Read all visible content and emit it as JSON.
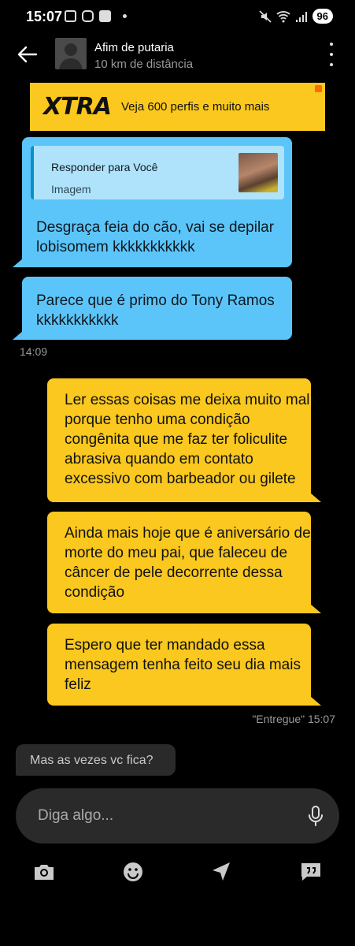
{
  "status_bar": {
    "time": "15:07",
    "battery": "96"
  },
  "header": {
    "name": "Afim de putaria",
    "distance": "10 km de distância"
  },
  "banner": {
    "logo": "XTRA",
    "text": "Veja 600 perfis e muito mais",
    "color": "#fac81e"
  },
  "conversation": {
    "incoming": [
      {
        "reply_to": "Responder para Você",
        "reply_type": "Imagem",
        "text": "Desgraça feia do cão, vai se depilar lobisomem kkkkkkkkkkk"
      },
      {
        "text": "Parece que é primo do Tony Ramos kkkkkkkkkkk"
      }
    ],
    "incoming_time": "14:09",
    "outgoing": [
      {
        "text": "Ler essas coisas me deixa muito mal porque tenho uma condição congênita que me faz ter foliculite abrasiva quando em contato excessivo com barbeador ou gilete"
      },
      {
        "text": "Ainda mais hoje que é aniversário de morte do meu pai, que faleceu de câncer de pele decorrente dessa condição"
      },
      {
        "text": "Espero que ter mandado essa mensagem tenha feito seu dia mais feliz"
      }
    ],
    "delivery_status": "\"Entregue\" 15:07",
    "latest_incoming": "Mas as vezes vc fica?"
  },
  "composer": {
    "placeholder": "Diga algo..."
  },
  "colors": {
    "incoming_bubble": "#5bc5f9",
    "outgoing_bubble": "#fac81e",
    "background": "#000000"
  },
  "icons": {
    "toolbar": [
      "camera-icon",
      "emoji-icon",
      "location-icon",
      "quick-replies-icon"
    ]
  }
}
